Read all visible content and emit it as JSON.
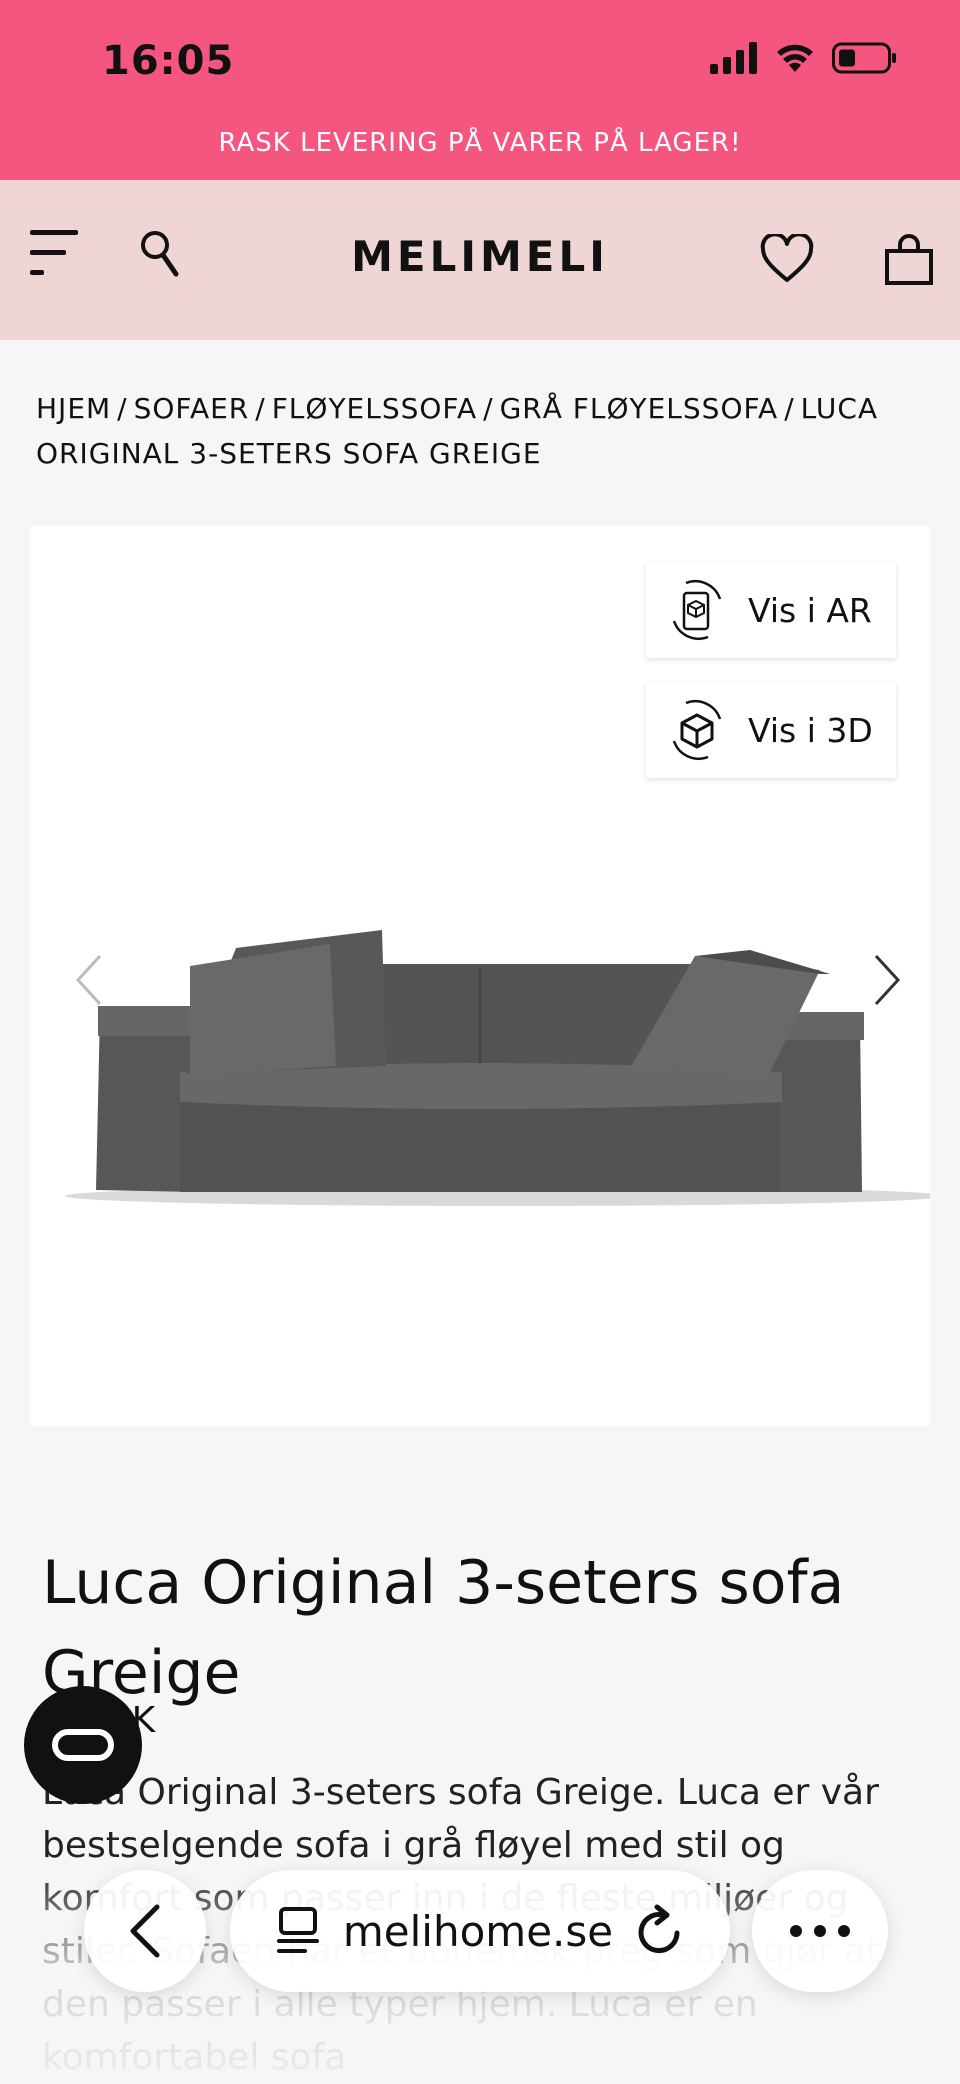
{
  "status_bar": {
    "time": "16:05"
  },
  "promo": {
    "text": "RASK LEVERING PÅ VARER PÅ LAGER!"
  },
  "header": {
    "logo": "MELIMELI"
  },
  "breadcrumb": {
    "items": [
      "HJEM",
      "SOFAER",
      "FLØYELSSOFA",
      "GRÅ FLØYELSSOFA",
      "LUCA ORIGINAL 3-SETERS SOFA GREIGE"
    ],
    "separator": "/"
  },
  "gallery": {
    "ar_label": "Vis i AR",
    "view3d_label": "Vis i 3D"
  },
  "product": {
    "title": "Luca Original 3-seters sofa Greige",
    "price": "5 NOK",
    "description": "Luca Original 3-seters sofa Greige. Luca er vår bestselgende sofa i grå fløyel med stil og komfort som passer inn i de fleste miljøer og stiler. Sofaen har et bohemsk preg som gjør at den passer i alle typer hjem. Luca er en komfortabel sofa"
  },
  "browser_bar": {
    "url": "melihome.se"
  },
  "colors": {
    "promo_bg": "#f5567f",
    "header_bg": "#efd5d4",
    "page_bg": "#f6f6f6"
  }
}
